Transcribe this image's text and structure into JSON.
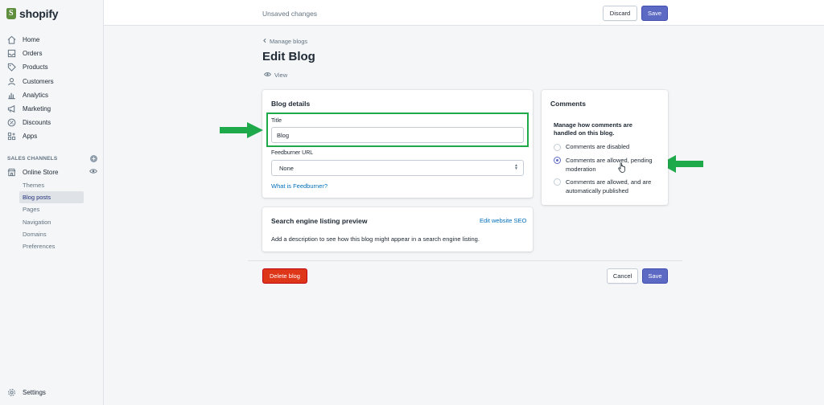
{
  "brand": {
    "name": "shopify"
  },
  "sidebar": {
    "items": [
      {
        "label": "Home",
        "icon": "home-icon"
      },
      {
        "label": "Orders",
        "icon": "orders-icon"
      },
      {
        "label": "Products",
        "icon": "tag-icon"
      },
      {
        "label": "Customers",
        "icon": "person-icon"
      },
      {
        "label": "Analytics",
        "icon": "bar-chart-icon"
      },
      {
        "label": "Marketing",
        "icon": "megaphone-icon"
      },
      {
        "label": "Discounts",
        "icon": "discount-icon"
      },
      {
        "label": "Apps",
        "icon": "apps-icon"
      }
    ],
    "sales_channels_label": "SALES CHANNELS",
    "online_store_label": "Online Store",
    "sub_items": [
      {
        "label": "Themes"
      },
      {
        "label": "Blog posts",
        "active": true
      },
      {
        "label": "Pages"
      },
      {
        "label": "Navigation"
      },
      {
        "label": "Domains"
      },
      {
        "label": "Preferences"
      }
    ],
    "settings_label": "Settings"
  },
  "topbar": {
    "status": "Unsaved changes",
    "discard_label": "Discard",
    "save_label": "Save"
  },
  "header": {
    "breadcrumb": "Manage blogs",
    "title": "Edit Blog",
    "view_label": "View"
  },
  "blog_details": {
    "title": "Blog details",
    "title_label": "Title",
    "title_value": "Blog",
    "feedburner_label": "Feedburner URL",
    "feedburner_value": "None",
    "feedburner_help": "What is Feedburner?"
  },
  "seo": {
    "title": "Search engine listing preview",
    "edit_link": "Edit website SEO",
    "description": "Add a description to see how this blog might appear in a search engine listing."
  },
  "comments": {
    "title": "Comments",
    "heading": "Manage how comments are handled on this blog.",
    "options": [
      {
        "label": "Comments are disabled",
        "checked": false
      },
      {
        "label": "Comments are allowed, pending moderation",
        "checked": true
      },
      {
        "label": "Comments are allowed, and are automatically published",
        "checked": false
      }
    ]
  },
  "footer": {
    "delete_label": "Delete blog",
    "cancel_label": "Cancel",
    "save_label": "Save"
  },
  "colors": {
    "primary": "#5c6ac4",
    "danger": "#de3618",
    "annotation": "#1ea94b",
    "link": "#006fbb"
  }
}
